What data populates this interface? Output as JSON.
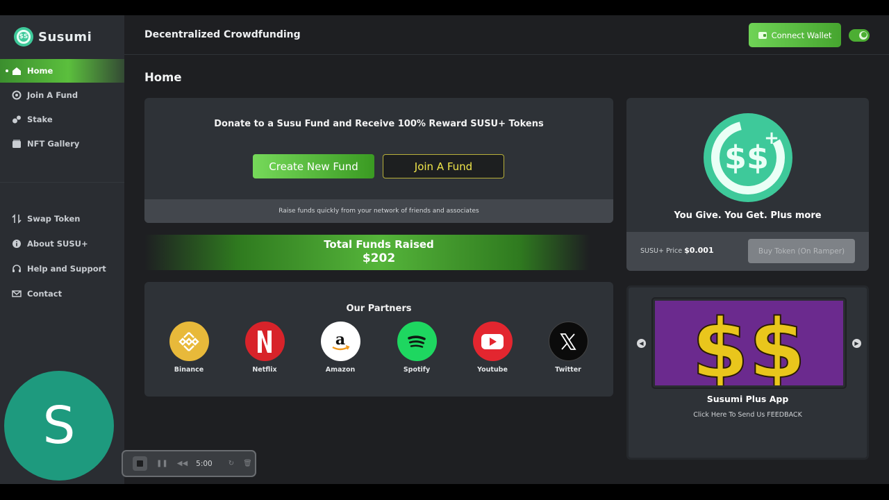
{
  "brand": {
    "name": "Susumi",
    "logo_text": "$S"
  },
  "sidebar": {
    "items": [
      {
        "label": "Home",
        "icon": "home-icon",
        "active": true
      },
      {
        "label": "Join A Fund",
        "icon": "fund-icon"
      },
      {
        "label": "Stake",
        "icon": "stake-icon"
      },
      {
        "label": "NFT Gallery",
        "icon": "gallery-icon"
      },
      {
        "label": "Swap Token",
        "icon": "swap-icon"
      },
      {
        "label": "About SUSU+",
        "icon": "info-icon"
      },
      {
        "label": "Help and Support",
        "icon": "headset-icon"
      },
      {
        "label": "Contact",
        "icon": "contact-icon"
      }
    ],
    "avatar_letter": "S"
  },
  "header": {
    "title": "Decentralized Crowdfunding",
    "connect_label": "Connect Wallet",
    "accent": "#5cc442"
  },
  "page": {
    "title": "Home"
  },
  "hero": {
    "title": "Donate to a Susu Fund and Receive 100% Reward SUSU+ Tokens",
    "create_label": "Create New Fund",
    "join_label": "Join A Fund",
    "footer": "Raise funds quickly from your network of friends and associates"
  },
  "funds": {
    "label": "Total Funds Raised",
    "value": "$202"
  },
  "partners": {
    "title": "Our Partners",
    "items": [
      {
        "name": "Binance",
        "icon": "binance-icon",
        "color": "#e8b93a"
      },
      {
        "name": "Netflix",
        "icon": "netflix-icon",
        "color": "#d8232a"
      },
      {
        "name": "Amazon",
        "icon": "amazon-icon",
        "color": "#ffffff"
      },
      {
        "name": "Spotify",
        "icon": "spotify-icon",
        "color": "#1ed760"
      },
      {
        "name": "Youtube",
        "icon": "youtube-icon",
        "color": "#e3262f"
      },
      {
        "name": "Twitter",
        "icon": "x-icon",
        "color": "#0b0b0b"
      }
    ]
  },
  "token": {
    "tagline": "You Give. You Get. Plus more",
    "price_label": "SUSU+ Price",
    "price_value": "$0.001",
    "buy_label": "Buy Token (On Ramper)"
  },
  "app": {
    "name": "Susumi Plus App",
    "feedback": "Click Here To Send Us FEEDBACK"
  },
  "recorder": {
    "time": "5:00"
  }
}
